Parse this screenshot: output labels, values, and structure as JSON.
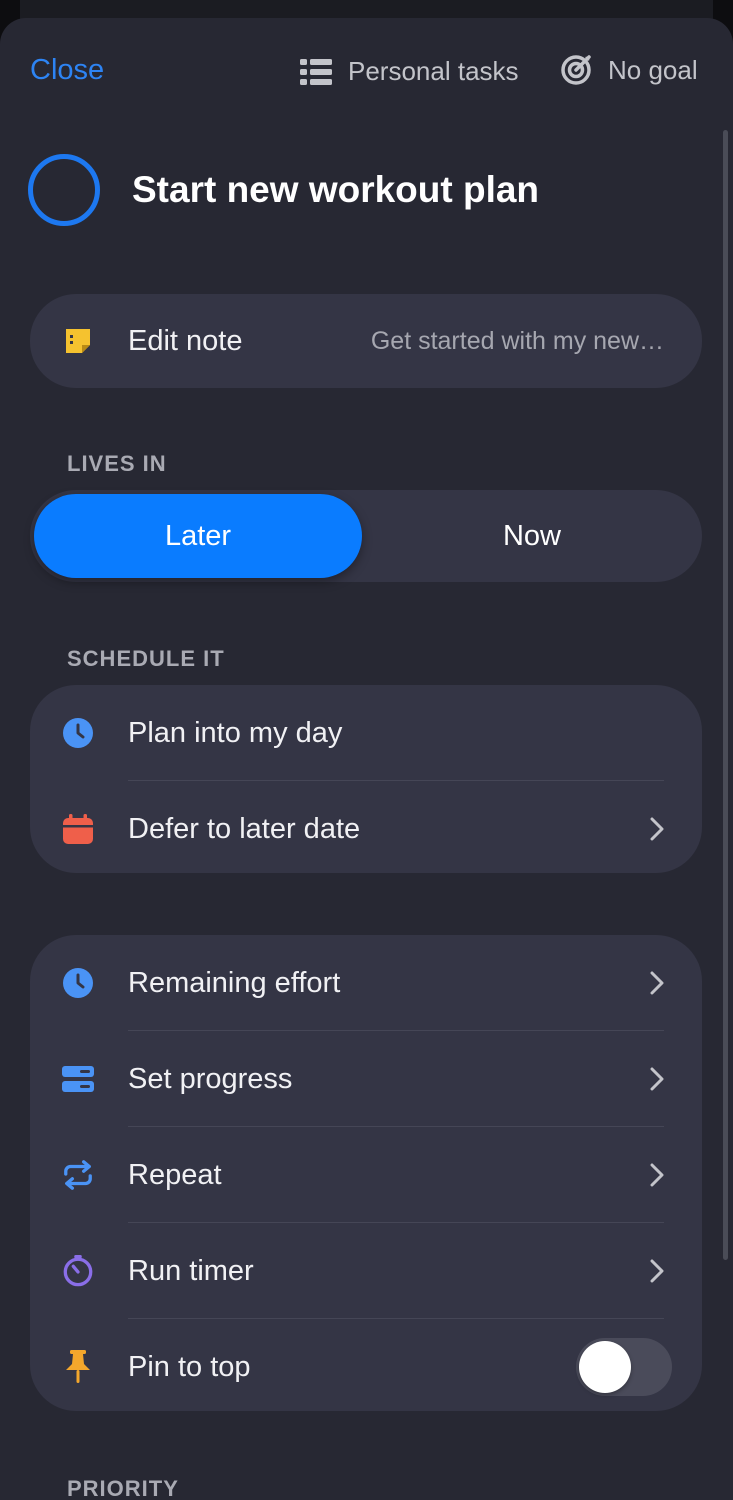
{
  "header": {
    "close_label": "Close",
    "list_label": "Personal tasks",
    "list_icon": "list-icon",
    "goal_label": "No goal",
    "goal_icon": "target-icon"
  },
  "task": {
    "title": "Start new workout plan",
    "completed": false
  },
  "note": {
    "label": "Edit note",
    "preview": "Get started with my new…",
    "icon": "note-icon"
  },
  "lives_in": {
    "section_label": "LIVES IN",
    "options": [
      "Later",
      "Now"
    ],
    "selected": "Later"
  },
  "schedule": {
    "section_label": "SCHEDULE IT",
    "items": [
      {
        "label": "Plan into my day",
        "icon": "clock-icon"
      },
      {
        "label": "Defer to later date",
        "icon": "calendar-icon"
      }
    ]
  },
  "details": {
    "items": [
      {
        "label": "Remaining effort",
        "icon": "clock-icon"
      },
      {
        "label": "Set progress",
        "icon": "progress-icon"
      },
      {
        "label": "Repeat",
        "icon": "repeat-icon"
      },
      {
        "label": "Run timer",
        "icon": "timer-icon"
      },
      {
        "label": "Pin to top",
        "icon": "pin-icon",
        "toggle_on": false
      }
    ]
  },
  "priority": {
    "section_label": "PRIORITY"
  },
  "colors": {
    "accent": "#0a7cff",
    "background": "#272833",
    "card": "#343545"
  }
}
